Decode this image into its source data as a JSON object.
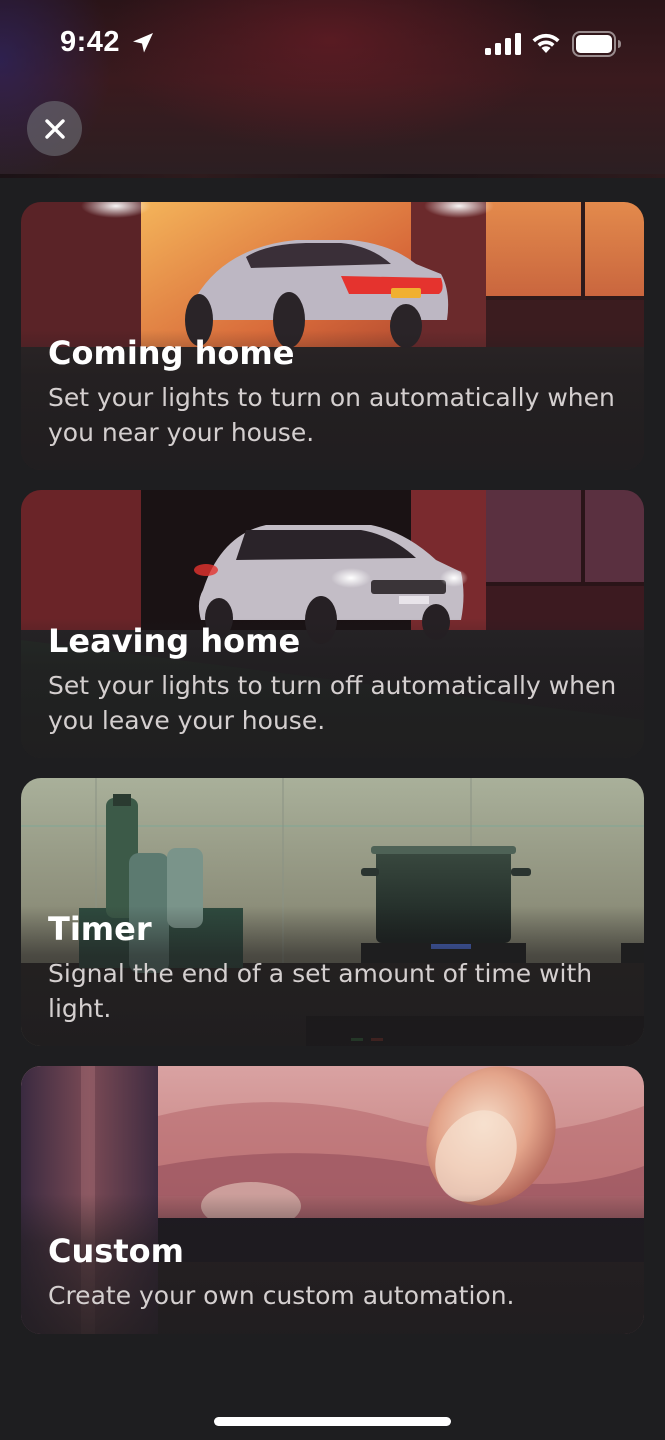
{
  "status_bar": {
    "time": "9:42",
    "icons": [
      "location-arrow-icon",
      "cellular-signal-icon",
      "wifi-icon",
      "battery-icon"
    ]
  },
  "header": {
    "close_icon": "close-icon"
  },
  "cards": [
    {
      "title": "Coming home",
      "description": "Set your lights to turn on automatically when you near your house."
    },
    {
      "title": "Leaving home",
      "description": "Set your lights to turn off automatically when you leave your house."
    },
    {
      "title": "Timer",
      "description": "Signal the end of a set amount of time with light."
    },
    {
      "title": "Custom",
      "description": "Create your own custom automation."
    }
  ],
  "colors": {
    "background": "#1e1e20",
    "card_text": "#ffffff",
    "card_subtext": "#d4cfcf"
  }
}
